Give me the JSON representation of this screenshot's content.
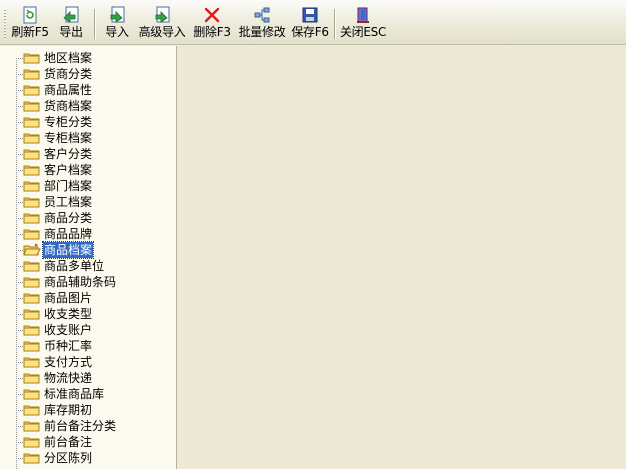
{
  "toolbar": {
    "buttons": [
      {
        "label": "刷新F5",
        "icon": "refresh-icon"
      },
      {
        "label": "导出",
        "icon": "export-icon"
      },
      {
        "label": "导入",
        "icon": "import-icon"
      },
      {
        "label": "高级导入",
        "icon": "advanced-import-icon"
      },
      {
        "label": "删除F3",
        "icon": "delete-icon"
      },
      {
        "label": "批量修改",
        "icon": "batch-edit-icon"
      },
      {
        "label": "保存F6",
        "icon": "save-icon"
      },
      {
        "label": "关闭ESC",
        "icon": "close-door-icon"
      }
    ]
  },
  "tree": {
    "selected": "商品档案",
    "items": [
      "地区档案",
      "货商分类",
      "商品属性",
      "货商档案",
      "专柜分类",
      "专柜档案",
      "客户分类",
      "客户档案",
      "部门档案",
      "员工档案",
      "商品分类",
      "商品品牌",
      "商品档案",
      "商品多单位",
      "商品辅助条码",
      "商品图片",
      "收支类型",
      "收支账户",
      "币种汇率",
      "支付方式",
      "物流快递",
      "标准商品库",
      "库存期初",
      "前台备注分类",
      "前台备注",
      "分区陈列"
    ]
  },
  "colors": {
    "selection": "#316AC5",
    "tree_bg": "#FCFAEF",
    "window_bg": "#ECE9D8"
  }
}
